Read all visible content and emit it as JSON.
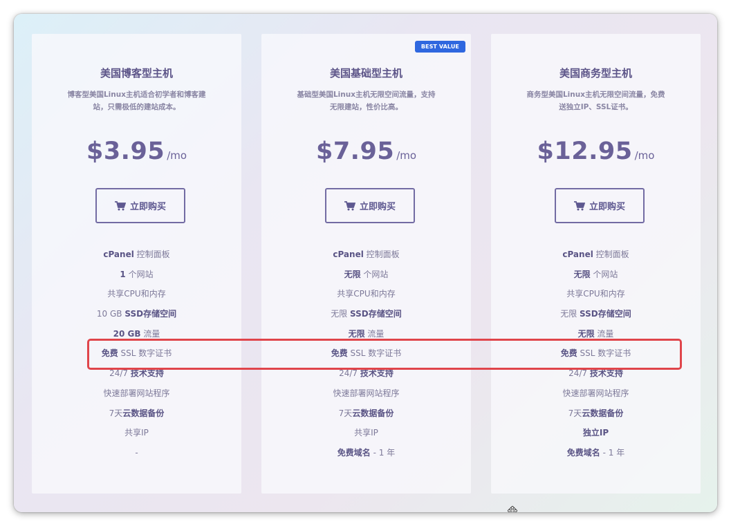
{
  "cart_icon": "shopping-cart-icon",
  "accent_color": "#6a6198",
  "badge_color": "#2f67df",
  "highlight_color": "#e0454b",
  "plans": [
    {
      "title": "美国博客型主机",
      "desc": "博客型美国Linux主机适合初学者和博客建站，只需极低的建站成本。",
      "price": "$3.95",
      "unit": "/mo",
      "button": "立即购买",
      "features": [
        {
          "strong": "cPanel",
          "text": " 控制面板",
          "strong_first": true
        },
        {
          "strong": "1",
          "text": " 个网站",
          "strong_first": true
        },
        {
          "strong": "",
          "text": "共享CPU和内存",
          "strong_first": true
        },
        {
          "strong": "SSD存储空间",
          "text": "10 GB ",
          "strong_first": false
        },
        {
          "strong": "20 GB",
          "text": " 流量",
          "strong_first": true
        },
        {
          "strong": "免费",
          "text": " SSL 数字证书",
          "strong_first": true
        },
        {
          "strong": "技术支持",
          "text": "24/7 ",
          "strong_first": false
        },
        {
          "strong": "",
          "text": "快速部署网站程序",
          "strong_first": true
        },
        {
          "strong": "云数据备份",
          "text": "7天",
          "strong_first": false
        },
        {
          "strong": "",
          "text": "共享IP",
          "strong_first": true
        },
        {
          "strong": "",
          "text": "-",
          "strong_first": true
        }
      ]
    },
    {
      "title": "美国基础型主机",
      "badge": "BEST VALUE",
      "desc": "基础型美国Linux主机无限空间流量，支持无限建站，性价比高。",
      "price": "$7.95",
      "unit": "/mo",
      "button": "立即购买",
      "features": [
        {
          "strong": "cPanel",
          "text": " 控制面板",
          "strong_first": true
        },
        {
          "strong": "无限",
          "text": " 个网站",
          "strong_first": true
        },
        {
          "strong": "",
          "text": "共享CPU和内存",
          "strong_first": true
        },
        {
          "strong": "SSD存储空间",
          "text": "无限 ",
          "strong_first": false
        },
        {
          "strong": "无限",
          "text": " 流量",
          "strong_first": true
        },
        {
          "strong": "免费",
          "text": " SSL 数字证书",
          "strong_first": true
        },
        {
          "strong": "技术支持",
          "text": "24/7 ",
          "strong_first": false
        },
        {
          "strong": "",
          "text": "快速部署网站程序",
          "strong_first": true
        },
        {
          "strong": "云数据备份",
          "text": "7天",
          "strong_first": false
        },
        {
          "strong": "",
          "text": "共享IP",
          "strong_first": true
        },
        {
          "strong": "免费域名",
          "text": " - 1 年",
          "strong_first": true
        }
      ]
    },
    {
      "title": "美国商务型主机",
      "desc": "商务型美国Linux主机无限空间流量，免费送独立IP、SSL证书。",
      "price": "$12.95",
      "unit": "/mo",
      "button": "立即购买",
      "features": [
        {
          "strong": "cPanel",
          "text": " 控制面板",
          "strong_first": true
        },
        {
          "strong": "无限",
          "text": " 个网站",
          "strong_first": true
        },
        {
          "strong": "",
          "text": "共享CPU和内存",
          "strong_first": true
        },
        {
          "strong": "SSD存储空间",
          "text": "无限 ",
          "strong_first": false
        },
        {
          "strong": "无限",
          "text": " 流量",
          "strong_first": true
        },
        {
          "strong": "免费",
          "text": " SSL 数字证书",
          "strong_first": true
        },
        {
          "strong": "技术支持",
          "text": "24/7 ",
          "strong_first": false
        },
        {
          "strong": "",
          "text": "快速部署网站程序",
          "strong_first": true
        },
        {
          "strong": "云数据备份",
          "text": "7天",
          "strong_first": false
        },
        {
          "strong": "独立IP",
          "text": "",
          "strong_first": true
        },
        {
          "strong": "免费域名",
          "text": " - 1 年",
          "strong_first": true
        }
      ]
    }
  ]
}
